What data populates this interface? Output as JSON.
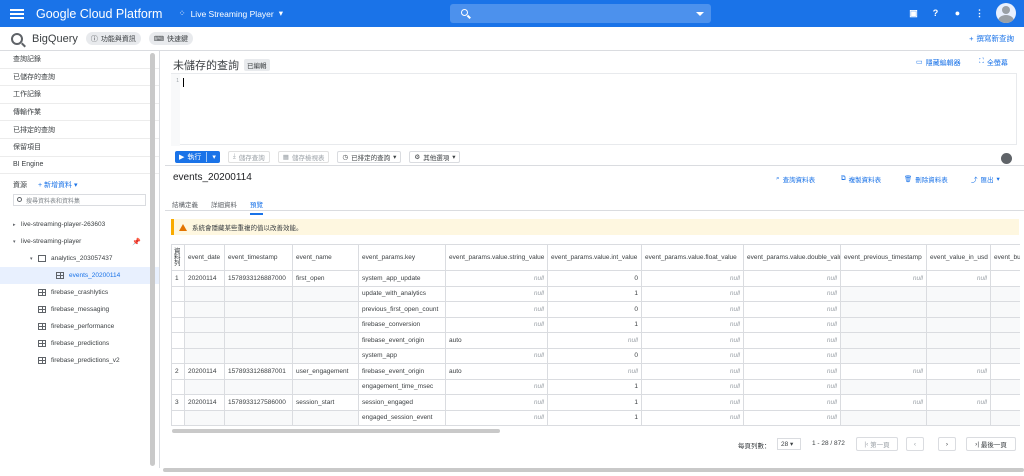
{
  "app": {
    "brand": "Google Cloud Platform",
    "project": "Live Streaming Player"
  },
  "subbar": {
    "product": "BigQuery",
    "chip1": "功能與資訊",
    "chip2": "快速鍵",
    "compose": "撰寫新查詢"
  },
  "sidebar": {
    "nav": [
      "查詢記錄",
      "已儲存的查詢",
      "工作記錄",
      "傳輸作業",
      "已排定的查詢",
      "保留項目",
      "BI Engine"
    ],
    "resources": "資源",
    "add_data": "新增資料",
    "search_placeholder": "搜尋資料表和資料集",
    "tree": [
      {
        "label": "live-streaming-player-263603",
        "indent": 1
      },
      {
        "label": "live-streaming-player",
        "indent": 1
      },
      {
        "label": "analytics_203057437",
        "indent": 2
      },
      {
        "label": "events_20200114",
        "indent": 3
      },
      {
        "label": "firebase_crashlytics",
        "indent": 2
      },
      {
        "label": "firebase_messaging",
        "indent": 2
      },
      {
        "label": "firebase_performance",
        "indent": 2
      },
      {
        "label": "firebase_predictions",
        "indent": 2
      },
      {
        "label": "firebase_predictions_v2",
        "indent": 2
      }
    ]
  },
  "editor": {
    "title": "未儲存的查詢",
    "edited": "已編輯",
    "hide": "隱藏編輯器",
    "fullscreen": "全螢幕",
    "line": "1"
  },
  "toolbar": {
    "run": "執行",
    "save_query": "儲存查詢",
    "save_view": "儲存檢視表",
    "schedule": "已排定的查詢",
    "more": "其他選項"
  },
  "table": {
    "name": "events_20200114",
    "query": "查詢資料表",
    "copy": "複製資料表",
    "delete": "刪除資料表",
    "export": "匯出",
    "tabs": [
      "結構定義",
      "詳細資料",
      "預覽"
    ],
    "warning": "系統會隱藏某些重複的值以改善效能。",
    "headers": [
      "資料列",
      "event_date",
      "event_timestamp",
      "event_name",
      "event_params.key",
      "event_params.value.string_value",
      "event_params.value.int_value",
      "event_params.value.float_value",
      "event_params.value.double_value",
      "event_previous_timestamp",
      "event_value_in_usd",
      "event_bu"
    ],
    "null": "null",
    "groups": [
      {
        "row": "1",
        "date": "20200114",
        "ts": "1578933126887000",
        "name": "first_open",
        "params": [
          {
            "key": "system_app_update",
            "s": null,
            "i": "0"
          },
          {
            "key": "update_with_analytics",
            "s": null,
            "i": "1"
          },
          {
            "key": "previous_first_open_count",
            "s": null,
            "i": "0"
          },
          {
            "key": "firebase_conversion",
            "s": null,
            "i": "1"
          },
          {
            "key": "firebase_event_origin",
            "s": "auto",
            "i": null
          },
          {
            "key": "system_app",
            "s": null,
            "i": "0"
          }
        ]
      },
      {
        "row": "2",
        "date": "20200114",
        "ts": "1578933126887001",
        "name": "user_engagement",
        "params": [
          {
            "key": "firebase_event_origin",
            "s": "auto",
            "i": null
          },
          {
            "key": "engagement_time_msec",
            "s": null,
            "i": "1"
          }
        ]
      },
      {
        "row": "3",
        "date": "20200114",
        "ts": "1578933127586000",
        "name": "session_start",
        "params": [
          {
            "key": "session_engaged",
            "s": null,
            "i": "1"
          },
          {
            "key": "engaged_session_event",
            "s": null,
            "i": "1"
          }
        ]
      }
    ]
  },
  "pager": {
    "rows_label": "每頁列數：",
    "rows": "28",
    "range": "1 - 28 / 872",
    "first": "第一頁",
    "last": "最後一頁"
  }
}
